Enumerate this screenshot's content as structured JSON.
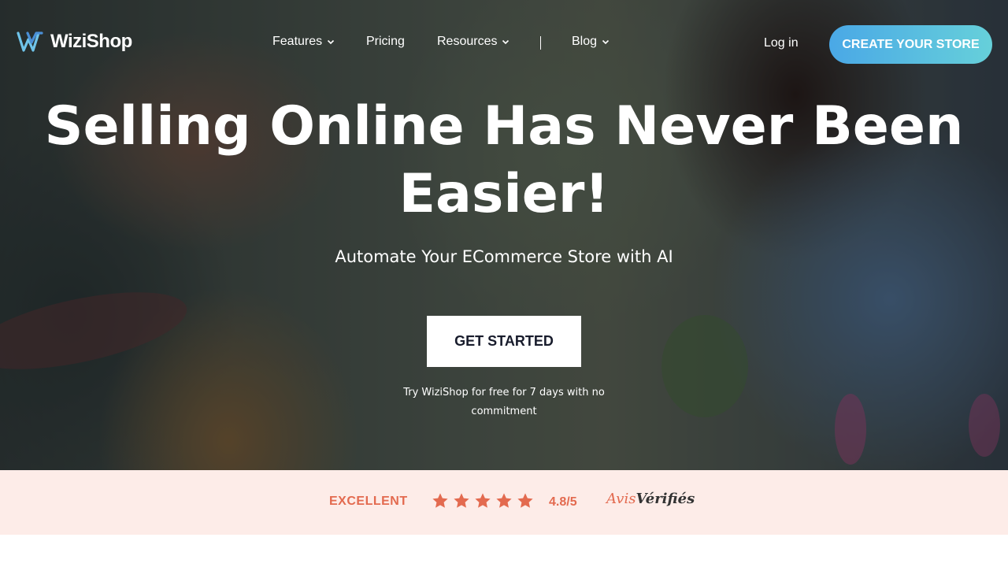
{
  "brand": {
    "name": "WiziShop"
  },
  "nav": {
    "items": [
      {
        "label": "Features"
      },
      {
        "label": "Pricing"
      },
      {
        "label": "Resources"
      },
      {
        "label": "Blog"
      }
    ],
    "login": "Log in",
    "cta": "CREATE YOUR STORE"
  },
  "hero": {
    "headline_line1": "Selling Online Has Never Been",
    "headline_line2": "Easier!",
    "subheadline": "Automate Your ECommerce Store with AI",
    "button": "GET STARTED",
    "note_line1": "Try WiziShop for free for 7 days with no",
    "note_line2": "commitment"
  },
  "reviews": {
    "rating_label": "EXCELLENT",
    "score": "4.8/5",
    "stars": 5,
    "brand_part1": "Avis",
    "brand_part2": "Vérifiés"
  },
  "colors": {
    "accent": "#e36a4f",
    "cta_gradient_start": "#4aa8e6",
    "cta_gradient_end": "#66d0da",
    "review_band": "#fdece8"
  }
}
